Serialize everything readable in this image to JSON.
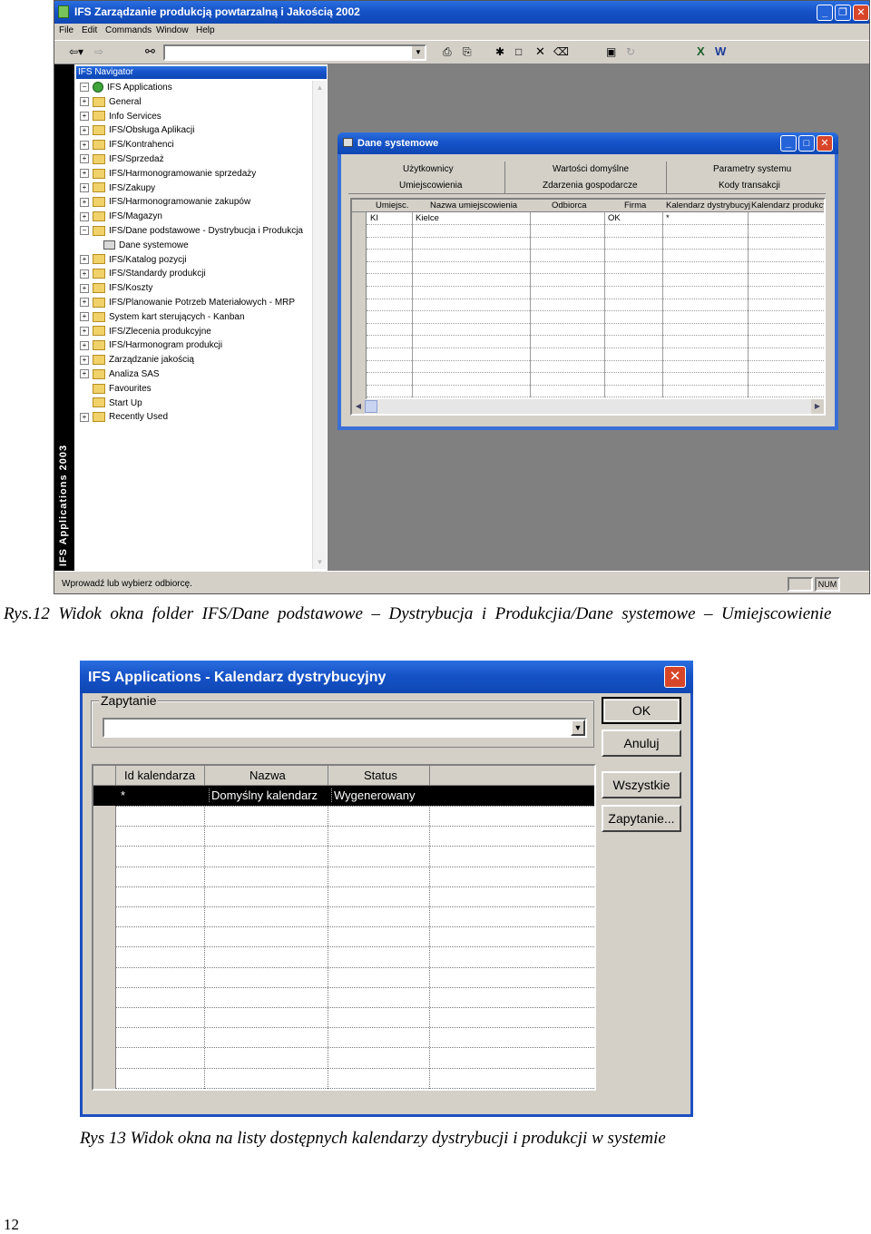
{
  "screenshot1": {
    "app_title": "IFS Zarządzanie produkcją powtarzalną i Jakością 2002",
    "menu": [
      "File",
      "Edit",
      "Commands",
      "Window",
      "Help"
    ],
    "side_banner": "IFS Applications 2003",
    "navigator": {
      "title": "IFS Navigator",
      "root": "IFS Applications",
      "items": [
        "General",
        "Info Services",
        "IFS/Obsługa Aplikacji",
        "IFS/Kontrahenci",
        "IFS/Sprzedaż",
        "IFS/Harmonogramowanie sprzedaży",
        "IFS/Zakupy",
        "IFS/Harmonogramowanie zakupów",
        "IFS/Magazyn",
        "IFS/Dane podstawowe - Dystrybucja i Produkcja",
        "Dane systemowe",
        "IFS/Katalog pozycji",
        "IFS/Standardy produkcji",
        "IFS/Koszty",
        "IFS/Planowanie Potrzeb Materiałowych - MRP",
        "System kart sterujących - Kanban",
        "IFS/Zlecenia produkcyjne",
        "IFS/Harmonogram produkcji",
        "Zarządzanie jakością",
        "Analiza SAS",
        "Favourites",
        "Start Up",
        "Recently Used"
      ]
    },
    "status_bar": {
      "message": "Wprowadź lub wybierz odbiorcę.",
      "num": "NUM"
    },
    "window": {
      "title": "Dane systemowe",
      "tabs_row1": [
        "Użytkownicy",
        "Wartości domyślne",
        "Parametry systemu"
      ],
      "tabs_row2": [
        "Umiejscowienia",
        "Zdarzenia gospodarcze",
        "Kody transakcji"
      ],
      "columns": [
        "Umiejsc.",
        "Nazwa umiejscowienia",
        "Odbiorca",
        "Firma",
        "Kalendarz dystrybucyj",
        "Kalendarz produkcy"
      ],
      "row": [
        "KI",
        "Kielce",
        "",
        "OK",
        "*",
        ""
      ]
    }
  },
  "caption1": "Rys.12  Widok  okna  folder  IFS/Dane  podstawowe  –  Dystrybucja  i  Produkcjia/Dane  systemowe  –  Umiejscowienie",
  "dialog": {
    "title": "IFS Applications - Kalendarz dystrybucyjny",
    "group_label": "Zapytanie",
    "buttons": [
      "OK",
      "Anuluj",
      "Wszystkie",
      "Zapytanie..."
    ],
    "columns": [
      "Id kalendarza",
      "Nazwa",
      "Status"
    ],
    "row": [
      "*",
      "Domyślny kalendarz",
      "Wygenerowany"
    ]
  },
  "caption2": "Rys 13 Widok okna na listy dostępnych kalendarzy dystrybucji i produkcji w systemie",
  "page_number": "12"
}
